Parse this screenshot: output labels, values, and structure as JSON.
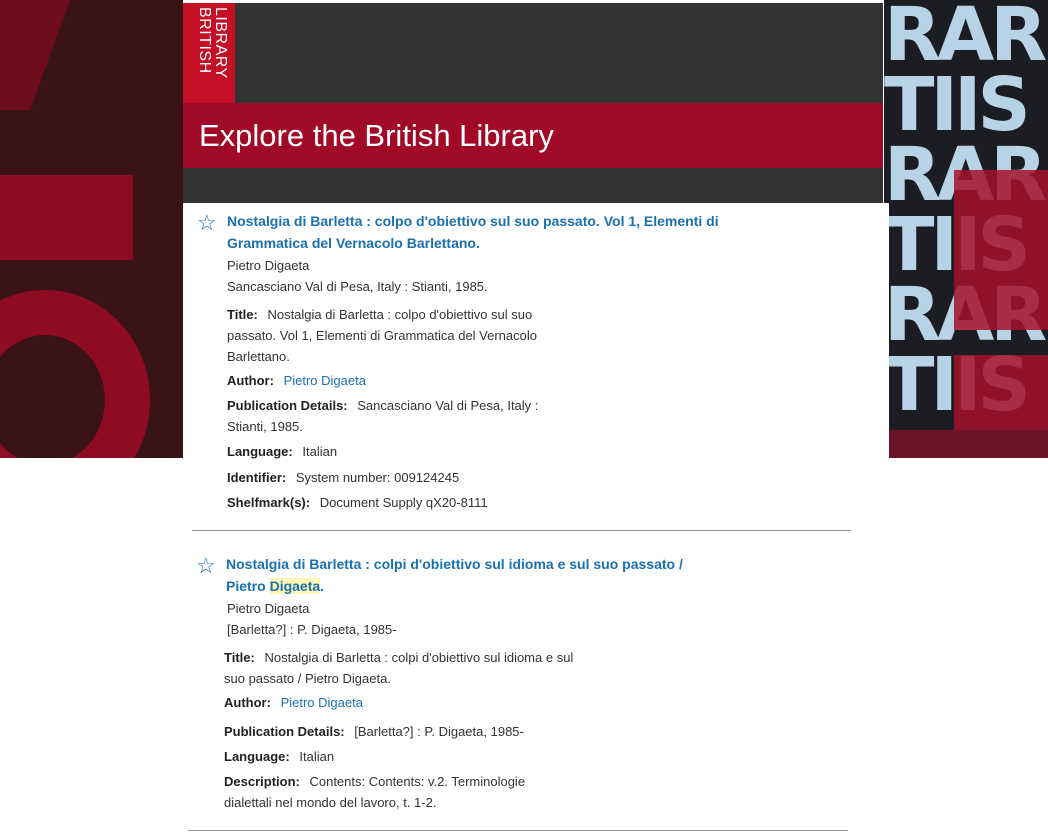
{
  "header": {
    "logo_line1": "BRITISH",
    "logo_line2": "LIBRARY",
    "title": "Explore the British Library"
  },
  "background_art": {
    "right_strips": [
      "RAR",
      "TIIS",
      "RAR",
      "TIIS",
      "RAR",
      "TIIS"
    ]
  },
  "colors": {
    "brand_red": "#a10a27",
    "logo_red": "#c50f25",
    "dark_bar": "#333333",
    "link_blue": "#1a70b0"
  },
  "records": [
    {
      "title_link": "Nostalgia di Barletta : colpo d'obiettivo sul suo passato. Vol 1, Elementi di Grammatica del Vernacolo Barlettano.",
      "author_line": "Pietro Digaeta",
      "imprint_line": "Sancasciano Val di Pesa, Italy : Stianti, 1985.",
      "fields": {
        "title_label": "Title:",
        "title_value": "Nostalgia di Barletta : colpo d'obiettivo sul suo passato. Vol 1, Elementi di Grammatica del Vernacolo Barlettano.",
        "author_label": "Author:",
        "author_value": "Pietro Digaeta",
        "pub_label": "Publication Details:",
        "pub_value": "Sancasciano Val di Pesa, Italy : Stianti, 1985.",
        "language_label": "Language:",
        "language_value": "Italian",
        "identifier_label": "Identifier:",
        "identifier_value": "System number: 009124245",
        "shelfmark_label": "Shelfmark(s):",
        "shelfmark_value": "Document Supply qX20-8111"
      }
    },
    {
      "title_link_part1": "Nostalgia di Barletta : colpi d'obiettivo sul idioma e sul suo passato /",
      "title_link_part2_pre": "Pietro ",
      "title_link_part2_hl": "Digaeta",
      "title_link_part2_post": ".",
      "author_line": "Pietro Digaeta",
      "imprint_line": "[Barletta?] : P. Digaeta, 1985-",
      "fields": {
        "title_label": "Title:",
        "title_value": "Nostalgia di Barletta : colpi d'obiettivo sul idioma e sul suo passato / Pietro Digaeta.",
        "author_label": "Author:",
        "author_value": "Pietro Digaeta",
        "pub_label": "Publication Details:",
        "pub_value": "[Barletta?] : P. Digaeta, 1985-",
        "language_label": "Language:",
        "language_value": "Italian",
        "description_label": "Description:",
        "description_value": "Contents: Contents: v.2. Terminologie dialettali nel mondo del lavoro, t. 1-2."
      }
    }
  ],
  "icons": {
    "favourite": "star-outline-icon"
  }
}
